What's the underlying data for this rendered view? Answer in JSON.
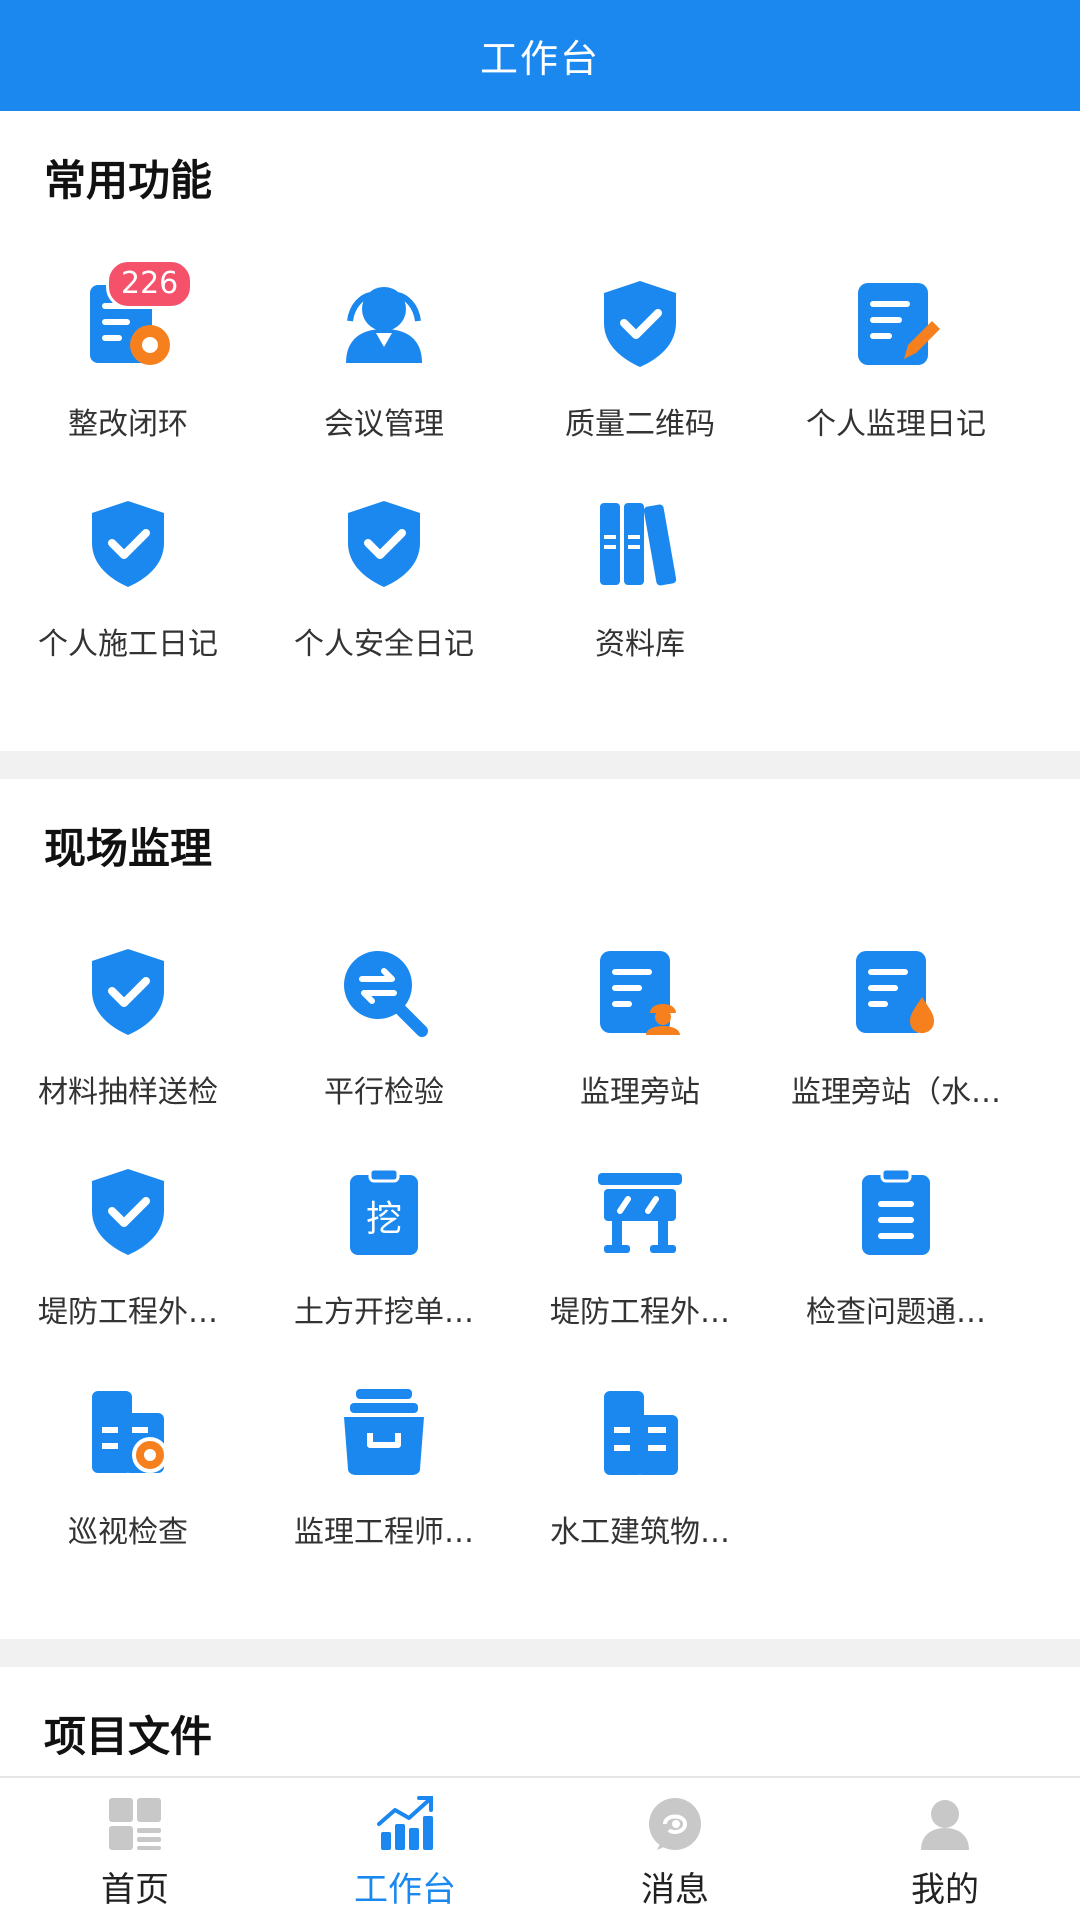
{
  "header": {
    "title": "工作台"
  },
  "common": {
    "title": "常用功能",
    "items": [
      {
        "label": "整改闭环",
        "icon": "doc-gear-icon",
        "badge": "226"
      },
      {
        "label": "会议管理",
        "icon": "people-icon"
      },
      {
        "label": "质量二维码",
        "icon": "shield-check-icon"
      },
      {
        "label": "个人监理日记",
        "icon": "doc-pencil-icon"
      },
      {
        "label": "个人施工日记",
        "icon": "shield-check-icon"
      },
      {
        "label": "个人安全日记",
        "icon": "shield-check-icon"
      },
      {
        "label": "资料库",
        "icon": "books-icon"
      }
    ]
  },
  "field": {
    "title": "现场监理",
    "items": [
      {
        "label": "材料抽样送检",
        "icon": "shield-check-icon"
      },
      {
        "label": "平行检验",
        "icon": "magnify-exchange-icon"
      },
      {
        "label": "监理旁站",
        "icon": "doc-worker-icon"
      },
      {
        "label": "监理旁站（水…",
        "icon": "doc-drop-icon"
      },
      {
        "label": "堤防工程外…",
        "icon": "shield-check-icon"
      },
      {
        "label": "土方开挖单…",
        "icon": "clipboard-dig-icon"
      },
      {
        "label": "堤防工程外…",
        "icon": "barrier-icon"
      },
      {
        "label": "检查问题通…",
        "icon": "clipboard-list-icon"
      },
      {
        "label": "巡视检查",
        "icon": "building-pin-icon"
      },
      {
        "label": "监理工程师…",
        "icon": "archive-box-icon"
      },
      {
        "label": "水工建筑物…",
        "icon": "building-icon"
      }
    ]
  },
  "files": {
    "title": "项目文件"
  },
  "tabbar": {
    "items": [
      {
        "label": "首页",
        "icon": "grid-home-icon"
      },
      {
        "label": "工作台",
        "icon": "chart-up-icon",
        "active": true
      },
      {
        "label": "消息",
        "icon": "message-icon"
      },
      {
        "label": "我的",
        "icon": "user-icon"
      }
    ]
  },
  "colors": {
    "primary": "#1a88ef",
    "accent": "#f7801e",
    "badge": "#f5516b",
    "inactive": "#c8c8c8"
  }
}
